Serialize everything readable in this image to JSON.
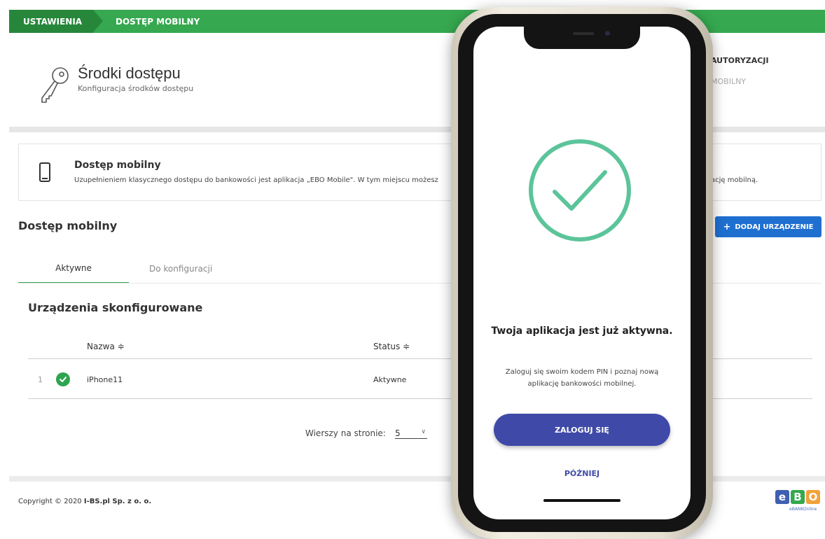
{
  "breadcrumb": {
    "item1": "USTAWIENIA",
    "item2": "DOSTĘP MOBILNY"
  },
  "header": {
    "title": "Środki dostępu",
    "subtitle": "Konfiguracja środków dostępu",
    "right_item1": "AUTORYZACJI",
    "right_item2": "MOBILNY"
  },
  "info": {
    "title": "Dostęp mobilny",
    "text": "Uzupełnieniem klasycznego dostępu do bankowości jest aplikacja „EBO Mobile\". W tym miejscu możesz",
    "tail": "ację mobilną."
  },
  "section": {
    "title": "Dostęp mobilny",
    "add_button": "DODAJ URZĄDZENIE"
  },
  "tabs": [
    {
      "label": "Aktywne"
    },
    {
      "label": "Do konfiguracji"
    }
  ],
  "table": {
    "title": "Urządzenia skonfigurowane",
    "columns": {
      "name": "Nazwa ≑",
      "status": "Status ≑"
    },
    "rows": [
      {
        "num": "1",
        "name": "iPhone11",
        "status": "Aktywne"
      }
    ]
  },
  "pagination": {
    "rows_label": "Wierszy na stronie:",
    "rows_value": "5"
  },
  "footer": {
    "copyright_prefix": "Copyright © 2020 ",
    "company": "I-BS.pl Sp. z o. o."
  },
  "logo": {
    "l1": "e",
    "l2": "B",
    "l3": "O",
    "tag": "eBANKOnline"
  },
  "colors": {
    "green": "#36a84f",
    "dark_green": "#26873a",
    "blue": "#1f6fd1",
    "indigo": "#3f4aa8",
    "mint": "#5cc49a"
  },
  "phone": {
    "title": "Twoja aplikacja jest już aktywna.",
    "text": "Zaloguj się swoim kodem PIN i poznaj nową aplikację bankowości mobilnej.",
    "login_button": "ZALOGUJ SIĘ",
    "later": "PÓŹNIEJ"
  }
}
